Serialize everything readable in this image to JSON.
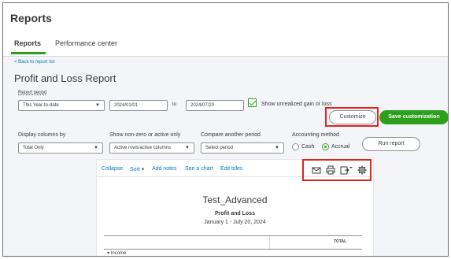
{
  "header": {
    "title": "Reports"
  },
  "tabs": [
    {
      "label": "Reports"
    },
    {
      "label": "Performance center"
    }
  ],
  "back_link": "< Back to report list",
  "report": {
    "title": "Profit and Loss Report",
    "period_label": "Report period",
    "period_value": "This Year-to-date",
    "start_date": "2024/01/01",
    "to_label": "to",
    "end_date": "2024/07/20",
    "unrealized_label": "Show unrealized gain or loss",
    "unrealized_checked": true
  },
  "buttons": {
    "customize": "Customize",
    "save_customization": "Save customization",
    "run_report": "Run report"
  },
  "filters": {
    "display_columns_label": "Display columns by",
    "display_columns_value": "Total Only",
    "nonzero_label": "Show non-zero or active only",
    "nonzero_value": "Active rows/active columns",
    "compare_label": "Compare another period",
    "compare_value": "Select period",
    "accounting_label": "Accounting method",
    "cash_label": "Cash",
    "accrual_label": "Accrual",
    "accounting_selected": "Accrual"
  },
  "toolbar": {
    "collapse": "Collapse",
    "sort": "Sort",
    "add_notes": "Add notes",
    "see_chart": "See a chart",
    "edit_titles": "Edit titles",
    "icons": [
      "envelope-icon",
      "printer-icon",
      "export-icon",
      "gear-icon"
    ]
  },
  "report_body": {
    "company": "Test_Advanced",
    "name": "Profit and Loss",
    "range": "January 1 - July 20, 2024",
    "column_header": "TOTAL",
    "first_row": "Income"
  },
  "colors": {
    "accent": "#2ca01c",
    "link": "#0077c5",
    "highlight": "#e1251b"
  }
}
